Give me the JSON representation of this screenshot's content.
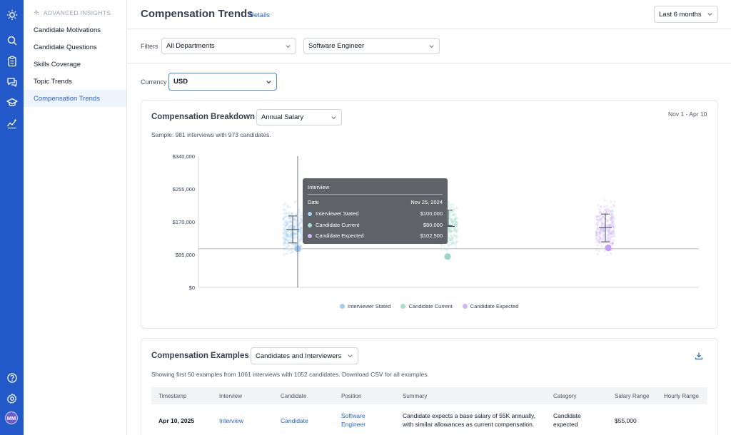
{
  "rail": {
    "icons": [
      "sun-logo-icon",
      "search-icon",
      "clipboard-icon",
      "chat-icon",
      "graduation-cap-icon",
      "insights-icon",
      "help-icon",
      "settings-icon"
    ],
    "avatar": "MM"
  },
  "sidebar": {
    "section": "ADVANCED INSIGHTS",
    "items": [
      {
        "label": "Candidate Motivations"
      },
      {
        "label": "Candidate Questions"
      },
      {
        "label": "Skills Coverage"
      },
      {
        "label": "Topic Trends"
      },
      {
        "label": "Compensation Trends",
        "active": true
      }
    ]
  },
  "header": {
    "title": "Compensation Trends",
    "details": "Details",
    "range": "Last 6 months"
  },
  "filters": {
    "label": "Filters",
    "department": "All Departments",
    "role": "Software Engineer"
  },
  "currency": {
    "label": "Currency",
    "value": "USD"
  },
  "breakdown": {
    "title": "Compensation Breakdown",
    "metric": "Annual Salary",
    "date_range": "Nov 1 - Apr 10",
    "sample": "Sample: 981 interviews with 973 candidates."
  },
  "chart_data": {
    "type": "scatter",
    "y_ticks": [
      "$340,000",
      "$255,000",
      "$170,000",
      "$85,000",
      "$0"
    ],
    "ylim": [
      0,
      340000
    ],
    "series": [
      {
        "name": "Interviewer Stated",
        "color": "#a5cdf0",
        "accent": "#9ec5ee",
        "median": 100000,
        "q1": 115000,
        "q3": 185000,
        "mid": 150000
      },
      {
        "name": "Candidate Current",
        "color": "#a8dfcc",
        "accent": "#9bd8c4",
        "median": 80000,
        "q1": 160000,
        "q3": 200000,
        "mid": 158000
      },
      {
        "name": "Candidate Expected",
        "color": "#cfb6f2",
        "accent": "#c79ef0",
        "median": 102500,
        "q1": 118000,
        "q3": 190000,
        "mid": 155000
      }
    ],
    "reference_line": 100000
  },
  "tooltip": {
    "header": "Interview",
    "date_label": "Date",
    "date_value": "Nov 25, 2024",
    "rows": [
      {
        "label": "Interviewer Stated",
        "value": "$100,000",
        "color": "#a5cdf0"
      },
      {
        "label": "Candidate Current",
        "value": "$80,000",
        "color": "#a8dfcc"
      },
      {
        "label": "Candidate Expected",
        "value": "$102,500",
        "color": "#cfb6f2"
      }
    ]
  },
  "examples": {
    "title": "Compensation Examples",
    "filter": "Candidates and Interviewers",
    "note": "Showing first 50 examples from 1061 interviews with 1052 candidates. Download CSV for all examples.",
    "columns": [
      "Timestamp",
      "Interview",
      "Candidate",
      "Position",
      "Summary",
      "Category",
      "Salary Range",
      "Hourly Range"
    ],
    "rows": [
      {
        "timestamp": "Apr 10, 2025",
        "interview": "Interview",
        "candidate": "Candidate",
        "position_1": "Software",
        "position_2": "Engineer",
        "summary_1": "Candidate expects a base salary of 55K annually,",
        "summary_2": "with similar allowances as current compensation.",
        "category_1": "Candidate",
        "category_2": "expected",
        "salary": "$55,000"
      }
    ]
  }
}
